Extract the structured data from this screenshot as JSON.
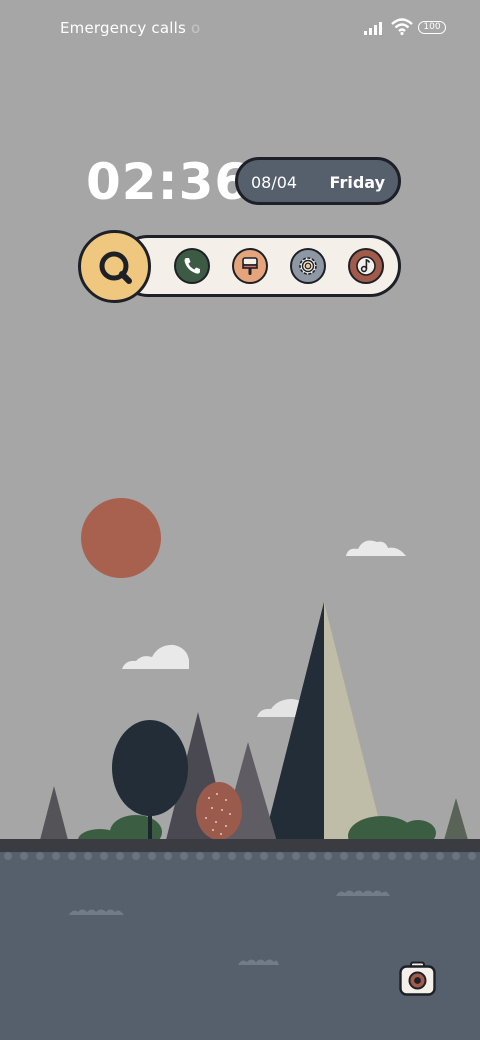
{
  "status_bar": {
    "carrier_text": "Emergency calls",
    "carrier_text_overflow": "o",
    "battery_level": "100",
    "icons": [
      "signal-icon",
      "wifi-icon",
      "battery-icon"
    ]
  },
  "lockscreen": {
    "time": "02:36",
    "date": "08/04",
    "weekday": "Friday"
  },
  "dock": {
    "search_icon": "search-icon",
    "apps": [
      {
        "icon": "phone-icon",
        "color": "#3c5a44"
      },
      {
        "icon": "brush-icon",
        "color": "#e6a47c"
      },
      {
        "icon": "settings-icon",
        "color": "#8e98a4"
      },
      {
        "icon": "music-icon",
        "color": "#a25a4a"
      }
    ]
  },
  "shortcut": {
    "icon": "camera-icon"
  },
  "colors": {
    "background": "#a6a6a6",
    "sun": "#a8604f",
    "water": "#565f6c",
    "search_accent": "#efc77f",
    "dark_outline": "#1d2127"
  }
}
